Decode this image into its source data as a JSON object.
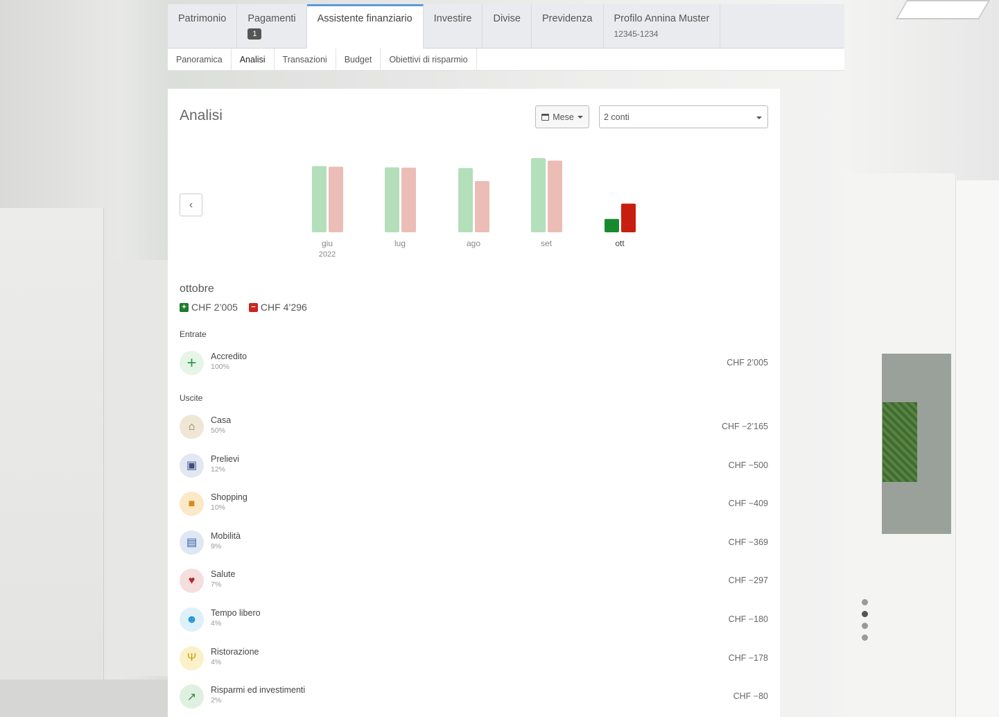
{
  "topnav": {
    "tabs": [
      {
        "label": "Patrimonio"
      },
      {
        "label": "Pagamenti",
        "badge": "1"
      },
      {
        "label": "Assistente finanziario",
        "active": true
      },
      {
        "label": "Investire"
      },
      {
        "label": "Divise"
      },
      {
        "label": "Previdenza"
      },
      {
        "label": "Profilo Annina Muster",
        "sub": "12345-1234"
      }
    ]
  },
  "subnav": {
    "items": [
      "Panoramica",
      "Analisi",
      "Transazioni",
      "Budget",
      "Obiettivi di risparmio"
    ],
    "active": "Analisi"
  },
  "panel": {
    "title": "Analisi",
    "period_button": "Mese",
    "accounts_select": "2 conti"
  },
  "chart_data": {
    "type": "bar",
    "categories": [
      "giu",
      "lug",
      "ago",
      "set",
      "ott"
    ],
    "category_sublabels": [
      "2022",
      "",
      "",
      "",
      ""
    ],
    "series": [
      {
        "values": [
          2080,
          2040,
          2020,
          2330,
          420
        ]
      },
      {
        "values": [
          2060,
          2030,
          1610,
          2250,
          900
        ]
      }
    ],
    "colors": {
      "income": "#b3dfbb",
      "expense": "#ebbdb6",
      "income_active": "#188a2e",
      "expense_active": "#c81e0f"
    },
    "active_index": 4
  },
  "summary": {
    "month": "ottobre",
    "income": "CHF 2’005",
    "expense": "CHF 4’296"
  },
  "income_section": {
    "label": "Entrate",
    "items": [
      {
        "name": "Accredito",
        "pct": "100%",
        "amount": "CHF 2’005",
        "icon": "plus-icon",
        "color": "#2f9a40",
        "bg": "#e6f5e8"
      }
    ]
  },
  "expense_section": {
    "label": "Uscite",
    "items": [
      {
        "name": "Casa",
        "pct": "50%",
        "amount": "CHF −2’165",
        "icon": "home-icon",
        "color": "#8a6a2f",
        "bg": "#efe6d6"
      },
      {
        "name": "Prelievi",
        "pct": "12%",
        "amount": "CHF −500",
        "icon": "atm-icon",
        "color": "#3c4f86",
        "bg": "#e3e7f1"
      },
      {
        "name": "Shopping",
        "pct": "10%",
        "amount": "CHF −409",
        "icon": "bag-icon",
        "color": "#d38d1a",
        "bg": "#fbe8c7"
      },
      {
        "name": "Mobilità",
        "pct": "9%",
        "amount": "CHF −369",
        "icon": "bus-icon",
        "color": "#2f5ea8",
        "bg": "#dfe7f3"
      },
      {
        "name": "Salute",
        "pct": "7%",
        "amount": "CHF −297",
        "icon": "heart-icon",
        "color": "#b32424",
        "bg": "#f6dede"
      },
      {
        "name": "Tempo libero",
        "pct": "4%",
        "amount": "CHF −180",
        "icon": "smile-icon",
        "color": "#1e8fd0",
        "bg": "#def0fa"
      },
      {
        "name": "Ristorazione",
        "pct": "4%",
        "amount": "CHF −178",
        "icon": "cutlery-icon",
        "color": "#c8a10d",
        "bg": "#fbf1c8"
      },
      {
        "name": "Risparmi ed investimenti",
        "pct": "2%",
        "amount": "CHF −80",
        "icon": "chart-up-icon",
        "color": "#2f8a3d",
        "bg": "#dff0e1"
      }
    ]
  }
}
